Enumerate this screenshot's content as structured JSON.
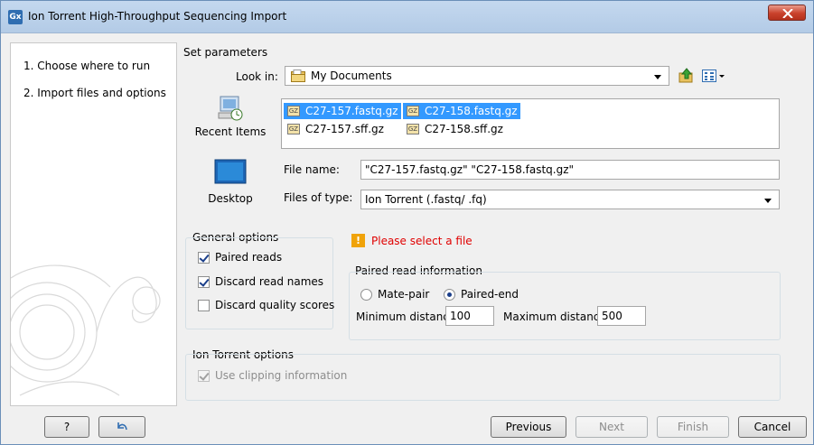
{
  "window": {
    "title": "Ion Torrent High-Throughput Sequencing Import",
    "app_icon": "Gx"
  },
  "steps": [
    {
      "label": "1.  Choose where to run"
    },
    {
      "label": "2.  Import files and options"
    }
  ],
  "set_parameters": {
    "header": "Set parameters"
  },
  "look_in": {
    "label": "Look in:",
    "value": "My Documents"
  },
  "places": [
    {
      "label": "Recent Items",
      "icon": "recent-items-icon"
    },
    {
      "label": "Desktop",
      "icon": "desktop-icon"
    }
  ],
  "files": [
    {
      "name": "C27-157.fastq.gz",
      "selected": true
    },
    {
      "name": "C27-158.fastq.gz",
      "selected": true
    },
    {
      "name": "C27-157.sff.gz",
      "selected": false
    },
    {
      "name": "C27-158.sff.gz",
      "selected": false
    }
  ],
  "file_name": {
    "label": "File name:",
    "value": "\"C27-157.fastq.gz\" \"C27-158.fastq.gz\""
  },
  "files_of_type": {
    "label": "Files of type:",
    "value": "Ion Torrent (.fastq/ .fq)"
  },
  "general_options": {
    "header": "General options",
    "paired_reads": {
      "label": "Paired reads",
      "checked": true
    },
    "discard_read_names": {
      "label": "Discard read names",
      "checked": true
    },
    "discard_quality_scores": {
      "label": "Discard quality scores",
      "checked": false
    }
  },
  "warning": {
    "text": "Please select a file",
    "icon": "!"
  },
  "paired_info": {
    "header": "Paired read information",
    "mate_pair": "Mate-pair",
    "paired_end": "Paired-end",
    "min_label": "Minimum distance",
    "min_value": "100",
    "max_label": "Maximum distance",
    "max_value": "500"
  },
  "ion_options": {
    "header": "Ion Torrent options",
    "use_clipping": {
      "label": "Use clipping information",
      "checked": true
    }
  },
  "buttons": {
    "help": "?",
    "previous": "Previous",
    "next": "Next",
    "finish": "Finish",
    "cancel": "Cancel"
  },
  "colors": {
    "selection": "#3399ff",
    "warning_text": "#e00000",
    "warning_icon": "#f0a30a",
    "titlebar": "#c4d8ef"
  }
}
